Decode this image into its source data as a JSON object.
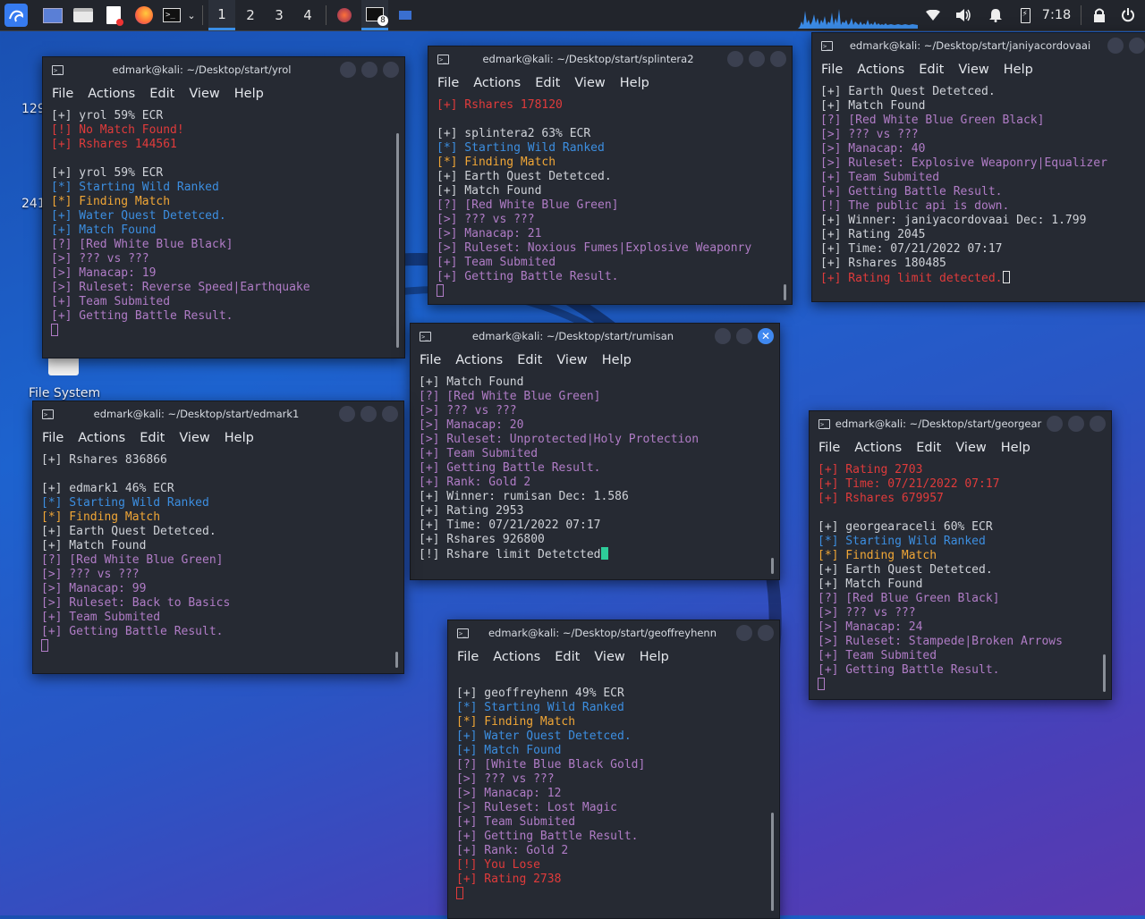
{
  "taskbar": {
    "workspaces": [
      "1",
      "2",
      "3",
      "4"
    ],
    "active_workspace": "1",
    "clock": "7:18",
    "badge": "8"
  },
  "desktop": {
    "label_129": "129",
    "label_241": "241",
    "filesystem_label": "File System"
  },
  "menu": {
    "file": "File",
    "actions": "Actions",
    "edit": "Edit",
    "view": "View",
    "help": "Help"
  },
  "terminals": {
    "yrol": {
      "title": "edmark@kali: ~/Desktop/start/yrol",
      "lines": [
        {
          "t": "[+] yrol 59% ECR",
          "c": "white"
        },
        {
          "t": "[!] No Match Found!",
          "c": "red"
        },
        {
          "t": "[+] Rshares 144561",
          "c": "red"
        },
        {
          "t": "",
          "c": "white"
        },
        {
          "t": "[+] yrol 59% ECR",
          "c": "white"
        },
        {
          "t": "[*] Starting Wild Ranked",
          "c": "blue"
        },
        {
          "t": "[*] Finding Match",
          "c": "orange"
        },
        {
          "t": "[+] Water Quest Detetced.",
          "c": "blue"
        },
        {
          "t": "[+] Match Found",
          "c": "blue"
        },
        {
          "t": "[?] [Red White Blue Black]",
          "c": "purple"
        },
        {
          "t": "[>] ??? vs ???",
          "c": "purple"
        },
        {
          "t": "[>] Manacap: 19",
          "c": "purple"
        },
        {
          "t": "[>] Ruleset: Reverse Speed|Earthquake",
          "c": "purple"
        },
        {
          "t": "[+] Team Submited",
          "c": "purple"
        },
        {
          "t": "[+] Getting Battle Result.",
          "c": "purple"
        }
      ]
    },
    "splintera2": {
      "title": "edmark@kali: ~/Desktop/start/splintera2",
      "lines": [
        {
          "t": "[+] Rshares 178120",
          "c": "red"
        },
        {
          "t": "",
          "c": "white"
        },
        {
          "t": "[+] splintera2 63% ECR",
          "c": "white"
        },
        {
          "t": "[*] Starting Wild Ranked",
          "c": "blue"
        },
        {
          "t": "[*] Finding Match",
          "c": "orange"
        },
        {
          "t": "[+] Earth Quest Detetced.",
          "c": "white"
        },
        {
          "t": "[+] Match Found",
          "c": "white"
        },
        {
          "t": "[?] [Red White Blue Green]",
          "c": "purple"
        },
        {
          "t": "[>] ??? vs ???",
          "c": "purple"
        },
        {
          "t": "[>] Manacap: 21",
          "c": "purple"
        },
        {
          "t": "[>] Ruleset: Noxious Fumes|Explosive Weaponry",
          "c": "purple"
        },
        {
          "t": "[+] Team Submited",
          "c": "purple"
        },
        {
          "t": "[+] Getting Battle Result.",
          "c": "purple"
        }
      ]
    },
    "janiyacordovaai": {
      "title": "edmark@kali: ~/Desktop/start/janiyacordovaai",
      "lines": [
        {
          "t": "[+] Earth Quest Detetced.",
          "c": "white"
        },
        {
          "t": "[+] Match Found",
          "c": "white"
        },
        {
          "t": "[?] [Red White Blue Green Black]",
          "c": "purple"
        },
        {
          "t": "[>] ??? vs ???",
          "c": "purple"
        },
        {
          "t": "[>] Manacap: 40",
          "c": "purple"
        },
        {
          "t": "[>] Ruleset: Explosive Weaponry|Equalizer",
          "c": "purple"
        },
        {
          "t": "[+] Team Submited",
          "c": "purple"
        },
        {
          "t": "[+] Getting Battle Result.",
          "c": "purple"
        },
        {
          "t": "[!] The public api is down.",
          "c": "purple"
        },
        {
          "t": "[+] Winner: janiyacordovaai Dec: 1.799",
          "c": "white"
        },
        {
          "t": "[+] Rating 2045",
          "c": "white"
        },
        {
          "t": "[+] Time: 07/21/2022 07:17",
          "c": "white"
        },
        {
          "t": "[+] Rshares 180485",
          "c": "white"
        },
        {
          "t": "[+] Rating limit detected.",
          "c": "red"
        }
      ]
    },
    "rumisan": {
      "title": "edmark@kali: ~/Desktop/start/rumisan",
      "lines": [
        {
          "t": "[+] Match Found",
          "c": "white"
        },
        {
          "t": "[?] [Red White Blue Green]",
          "c": "purple"
        },
        {
          "t": "[>] ??? vs ???",
          "c": "purple"
        },
        {
          "t": "[>] Manacap: 20",
          "c": "purple"
        },
        {
          "t": "[>] Ruleset: Unprotected|Holy Protection",
          "c": "purple"
        },
        {
          "t": "[+] Team Submited",
          "c": "purple"
        },
        {
          "t": "[+] Getting Battle Result.",
          "c": "purple"
        },
        {
          "t": "[+] Rank: Gold 2",
          "c": "purple"
        },
        {
          "t": "[+] Winner: rumisan Dec: 1.586",
          "c": "white"
        },
        {
          "t": "[+] Rating 2953",
          "c": "white"
        },
        {
          "t": "[+] Time: 07/21/2022 07:17",
          "c": "white"
        },
        {
          "t": "[+] Rshares 926800",
          "c": "white"
        },
        {
          "t": "[!] Rshare limit Detetcted",
          "c": "white"
        }
      ]
    },
    "edmark1": {
      "title": "edmark@kali: ~/Desktop/start/edmark1",
      "lines": [
        {
          "t": "[+] Rshares 836866",
          "c": "white"
        },
        {
          "t": "",
          "c": "white"
        },
        {
          "t": "[+] edmark1 46% ECR",
          "c": "white"
        },
        {
          "t": "[*] Starting Wild Ranked",
          "c": "blue"
        },
        {
          "t": "[*] Finding Match",
          "c": "orange"
        },
        {
          "t": "[+] Earth Quest Detetced.",
          "c": "white"
        },
        {
          "t": "[+] Match Found",
          "c": "white"
        },
        {
          "t": "[?] [Red White Blue Green]",
          "c": "purple"
        },
        {
          "t": "[>] ??? vs ???",
          "c": "purple"
        },
        {
          "t": "[>] Manacap: 99",
          "c": "purple"
        },
        {
          "t": "[>] Ruleset: Back to Basics",
          "c": "purple"
        },
        {
          "t": "[+] Team Submited",
          "c": "purple"
        },
        {
          "t": "[+] Getting Battle Result.",
          "c": "purple"
        }
      ]
    },
    "georgear": {
      "title": "edmark@kali: ~/Desktop/start/georgear",
      "lines": [
        {
          "t": "[+] Rating 2703",
          "c": "red"
        },
        {
          "t": "[+] Time: 07/21/2022 07:17",
          "c": "red"
        },
        {
          "t": "[+] Rshares 679957",
          "c": "red"
        },
        {
          "t": "",
          "c": "white"
        },
        {
          "t": "[+] georgearaceli 60% ECR",
          "c": "white"
        },
        {
          "t": "[*] Starting Wild Ranked",
          "c": "blue"
        },
        {
          "t": "[*] Finding Match",
          "c": "orange"
        },
        {
          "t": "[+] Earth Quest Detetced.",
          "c": "white"
        },
        {
          "t": "[+] Match Found",
          "c": "white"
        },
        {
          "t": "[?] [Red Blue Green Black]",
          "c": "purple"
        },
        {
          "t": "[>] ??? vs ???",
          "c": "purple"
        },
        {
          "t": "[>] Manacap: 24",
          "c": "purple"
        },
        {
          "t": "[>] Ruleset: Stampede|Broken Arrows",
          "c": "purple"
        },
        {
          "t": "[+] Team Submited",
          "c": "purple"
        },
        {
          "t": "[+] Getting Battle Result.",
          "c": "purple"
        }
      ]
    },
    "geoffreyhenn": {
      "title": "edmark@kali: ~/Desktop/start/geoffreyhenn",
      "lines": [
        {
          "t": "[+] geoffreyhenn 49% ECR",
          "c": "white"
        },
        {
          "t": "[*] Starting Wild Ranked",
          "c": "blue"
        },
        {
          "t": "[*] Finding Match",
          "c": "orange"
        },
        {
          "t": "[+] Water Quest Detetced.",
          "c": "blue"
        },
        {
          "t": "[+] Match Found",
          "c": "blue"
        },
        {
          "t": "[?] [White Blue Black Gold]",
          "c": "purple"
        },
        {
          "t": "[>] ??? vs ???",
          "c": "purple"
        },
        {
          "t": "[>] Manacap: 12",
          "c": "purple"
        },
        {
          "t": "[>] Ruleset: Lost Magic",
          "c": "purple"
        },
        {
          "t": "[+] Team Submited",
          "c": "purple"
        },
        {
          "t": "[+] Getting Battle Result.",
          "c": "purple"
        },
        {
          "t": "[+] Rank: Gold 2",
          "c": "purple"
        },
        {
          "t": "[!] You Lose",
          "c": "red"
        },
        {
          "t": "[+] Rating 2738",
          "c": "red"
        }
      ]
    }
  }
}
